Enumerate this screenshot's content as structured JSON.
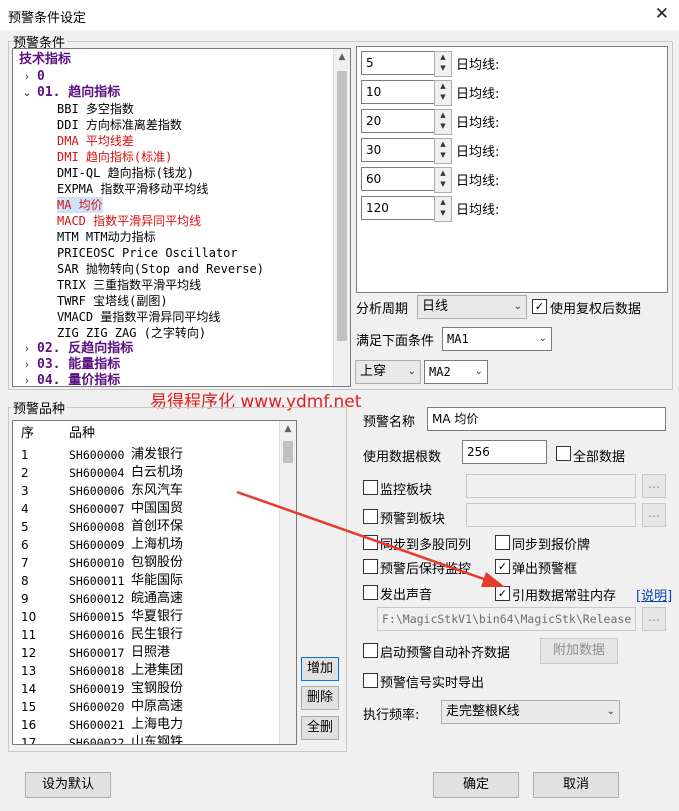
{
  "window": {
    "title": "预警条件设定",
    "close": "✕"
  },
  "conditions_group": {
    "legend": "预警条件"
  },
  "tree": {
    "root": "技术指标",
    "nodes": [
      {
        "label": "0",
        "toggle": "›"
      },
      {
        "label": "01. 趋向指标",
        "toggle": "⌄"
      },
      {
        "label": "BBI 多空指数"
      },
      {
        "label": "DDI 方向标准离差指数"
      },
      {
        "label": "DMA 平均线差"
      },
      {
        "label": "DMI 趋向指标(标准)"
      },
      {
        "label": "DMI-QL 趋向指标(钱龙)"
      },
      {
        "label": "EXPMA 指数平滑移动平均线"
      },
      {
        "label": "MA 均价"
      },
      {
        "label": "MACD 指数平滑异同平均线"
      },
      {
        "label": "MTM MTM动力指标"
      },
      {
        "label": "PRICEOSC Price Oscillator"
      },
      {
        "label": "SAR 抛物转向(Stop and Reverse)"
      },
      {
        "label": "TRIX 三重指数平滑平均线"
      },
      {
        "label": "TWRF 宝塔线(副图)"
      },
      {
        "label": "VMACD 量指数平滑异同平均线"
      },
      {
        "label": "ZIG ZIG ZAG (之字转向)"
      },
      {
        "label": "02. 反趋向指标",
        "toggle": "›"
      },
      {
        "label": "03. 能量指标",
        "toggle": "›"
      },
      {
        "label": "04. 量价指标",
        "toggle": "›"
      }
    ]
  },
  "params": [
    {
      "value": "5",
      "label": "日均线:"
    },
    {
      "value": "10",
      "label": "日均线:"
    },
    {
      "value": "20",
      "label": "日均线:"
    },
    {
      "value": "30",
      "label": "日均线:"
    },
    {
      "value": "60",
      "label": "日均线:"
    },
    {
      "value": "120",
      "label": "日均线:"
    }
  ],
  "period": {
    "label": "分析周期",
    "value": "日线"
  },
  "use_adjusted": {
    "label": "使用复权后数据",
    "checked": true
  },
  "condition": {
    "label": "满足下面条件",
    "value": "MA1"
  },
  "cross": {
    "value": "上穿",
    "target": "MA2"
  },
  "watermark": "易得程序化 www.ydmf.net",
  "stocks_group": {
    "legend": "预警品种"
  },
  "stocks": {
    "headers": [
      "序",
      "品种"
    ],
    "rows": [
      [
        "1",
        "SH600000",
        "浦发银行"
      ],
      [
        "2",
        "SH600004",
        "白云机场"
      ],
      [
        "3",
        "SH600006",
        "东风汽车"
      ],
      [
        "4",
        "SH600007",
        "中国国贸"
      ],
      [
        "5",
        "SH600008",
        "首创环保"
      ],
      [
        "6",
        "SH600009",
        "上海机场"
      ],
      [
        "7",
        "SH600010",
        "包钢股份"
      ],
      [
        "8",
        "SH600011",
        "华能国际"
      ],
      [
        "9",
        "SH600012",
        "皖通高速"
      ],
      [
        "10",
        "SH600015",
        "华夏银行"
      ],
      [
        "11",
        "SH600016",
        "民生银行"
      ],
      [
        "12",
        "SH600017",
        "日照港"
      ],
      [
        "13",
        "SH600018",
        "上港集团"
      ],
      [
        "14",
        "SH600019",
        "宝钢股份"
      ],
      [
        "15",
        "SH600020",
        "中原高速"
      ],
      [
        "16",
        "SH600021",
        "上海电力"
      ],
      [
        "17",
        "SH600022",
        "山东钢铁"
      ]
    ]
  },
  "stock_buttons": {
    "add": "增加",
    "remove": "删除",
    "select_all": "全删"
  },
  "alert_name": {
    "label": "预警名称",
    "value": "MA 均价"
  },
  "data_count": {
    "label": "使用数据根数",
    "value": "256"
  },
  "all_data": {
    "label": "全部数据",
    "checked": false
  },
  "monitor_block": {
    "label": "监控板块",
    "checked": false,
    "browse": "..."
  },
  "alert_block": {
    "label": "预警到板块",
    "checked": false,
    "browse": "..."
  },
  "sync_multi": {
    "label": "同步到多股同列",
    "checked": false
  },
  "sync_quote": {
    "label": "同步到报价牌",
    "checked": false
  },
  "keep_monitor": {
    "label": "预警后保持监控",
    "checked": false
  },
  "popup": {
    "label": "弹出预警框",
    "checked": true
  },
  "sound": {
    "label": "发出声音",
    "checked": false
  },
  "resident": {
    "label": "引用数据常驻内存",
    "checked": true
  },
  "help_link": "[说明]",
  "sound_path": {
    "value": "F:\\MagicStkV1\\bin64\\MagicStk\\Release",
    "browse": "..."
  },
  "auto_fill": {
    "label": "启动预警自动补齐数据",
    "checked": false
  },
  "extra_data_button": "附加数据",
  "realtime_export": {
    "label": "预警信号实时导出",
    "checked": false
  },
  "frequency": {
    "label": "执行频率:",
    "value": "走完整根K线"
  },
  "footer": {
    "default": "设为默认",
    "ok": "确定",
    "cancel": "取消"
  },
  "colors": {
    "purple": "#5b1182",
    "red": "#d81010",
    "selection": "#cce4f7",
    "arrow": "#e53b2c",
    "watermark": "#e02020"
  }
}
